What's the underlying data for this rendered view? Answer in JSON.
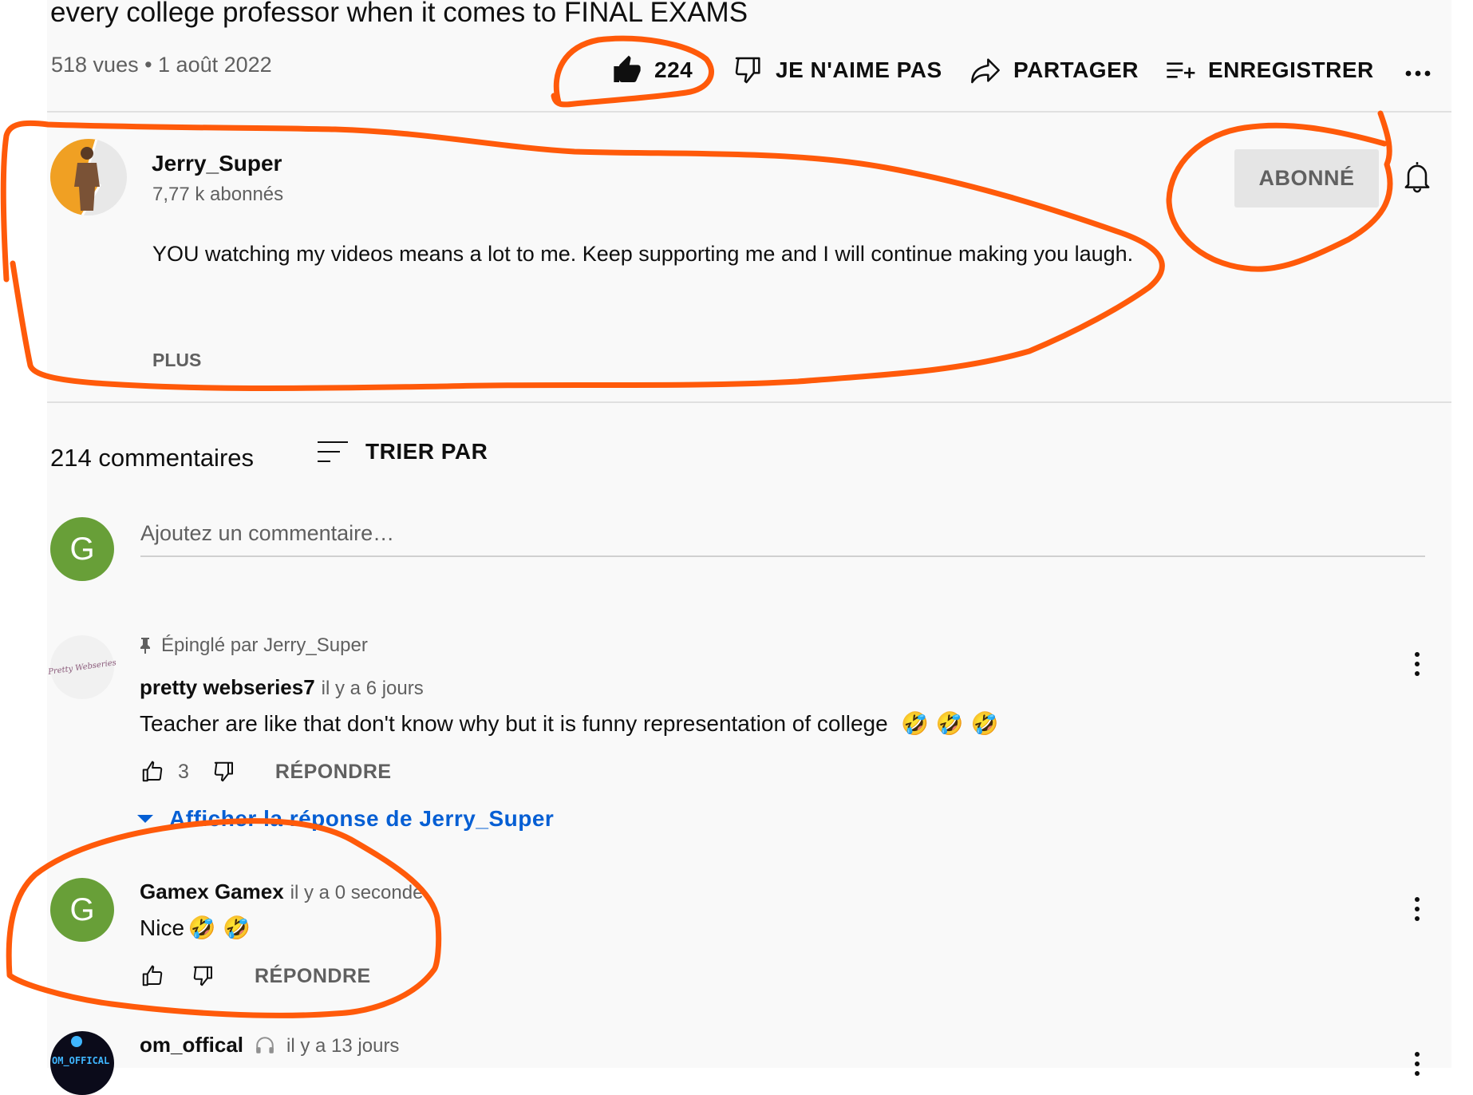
{
  "video": {
    "title": "every college professor when it comes to FINAL EXAMS",
    "meta": "518 vues • 1 août 2022"
  },
  "actions": {
    "like_count": "224",
    "dislike_label": "JE N'AIME PAS",
    "share_label": "PARTAGER",
    "save_label": "ENREGISTRER",
    "more_label": "..."
  },
  "channel": {
    "name": "Jerry_Super",
    "subscribers": "7,77 k abonnés",
    "description": "YOU watching my videos means a lot to me. Keep supporting me and I will continue making you laugh.",
    "more_label": "PLUS",
    "subscribe_label": "ABONNÉ"
  },
  "comments_section": {
    "count_label": "214 commentaires",
    "sort_label": "TRIER PAR",
    "user_initial": "G",
    "add_placeholder": "Ajoutez un commentaire…"
  },
  "comments": [
    {
      "pinned_label": "Épinglé par Jerry_Super",
      "author": "pretty webseries7",
      "time": "il y a 6 jours",
      "text": "Teacher are like that don't know why  but it is funny representation of college",
      "emoji": "🤣 🤣 🤣",
      "likes": "3",
      "reply_label": "RÉPONDRE",
      "show_reply_label": "Afficher la réponse de Jerry_Super",
      "avatar_text": "Pretty Webseries"
    },
    {
      "author": "Gamex Gamex",
      "time": "il y a 0 seconde",
      "text": "Nice",
      "emoji": "🤣 🤣",
      "initial": "G",
      "reply_label": "RÉPONDRE"
    },
    {
      "author": "om_offical",
      "time": "il y a 13 jours",
      "avatar_text": "OM_OFFICAL"
    }
  ],
  "colors": {
    "annotation": "#ff5a0a",
    "link_blue": "#065fd4",
    "avatar_green": "#689f38",
    "avatar_orange": "#f0a023"
  }
}
